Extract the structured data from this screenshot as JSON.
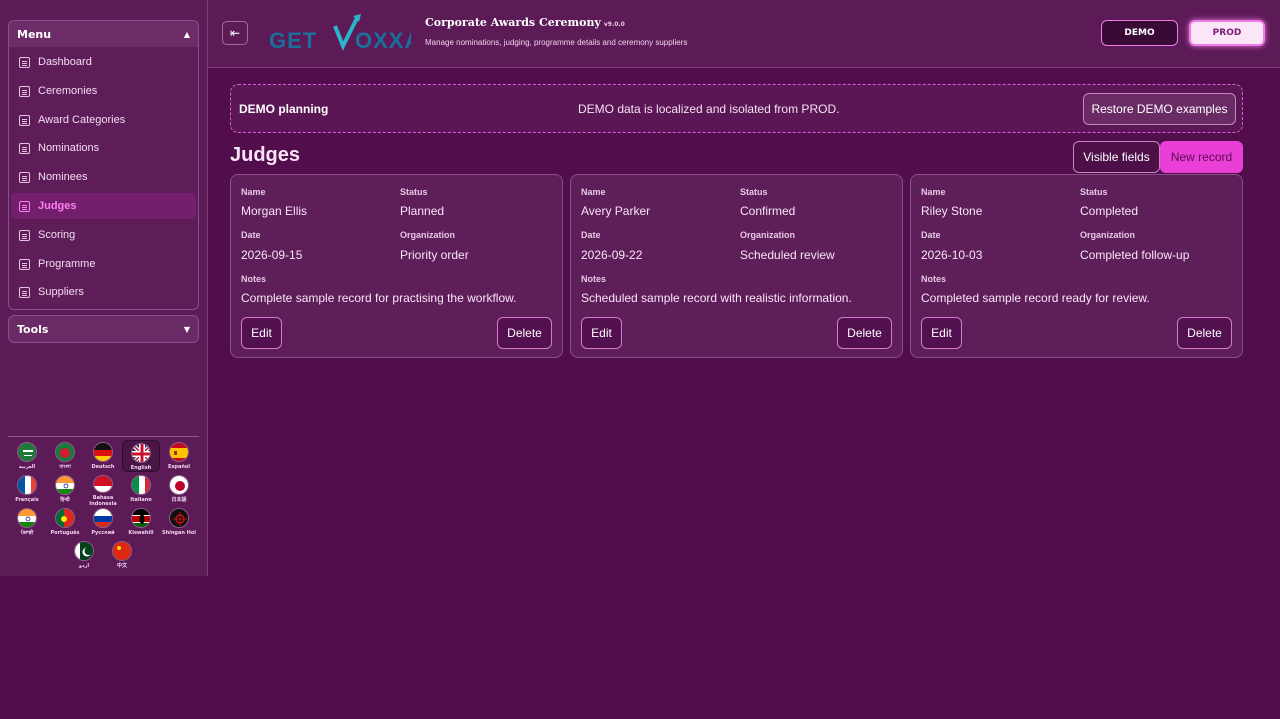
{
  "sidebar": {
    "menu_title": "Menu",
    "tools_title": "Tools",
    "items": [
      {
        "label": "Dashboard",
        "active": false
      },
      {
        "label": "Ceremonies",
        "active": false
      },
      {
        "label": "Award Categories",
        "active": false
      },
      {
        "label": "Nominations",
        "active": false
      },
      {
        "label": "Nominees",
        "active": false
      },
      {
        "label": "Judges",
        "active": true
      },
      {
        "label": "Scoring",
        "active": false
      },
      {
        "label": "Programme",
        "active": false
      },
      {
        "label": "Suppliers",
        "active": false
      }
    ],
    "languages": [
      {
        "label": "العربية",
        "flag": "saudi-arabia"
      },
      {
        "label": "বাংলা",
        "flag": "bangladesh"
      },
      {
        "label": "Deutsch",
        "flag": "germany"
      },
      {
        "label": "English",
        "flag": "united-kingdom",
        "selected": true
      },
      {
        "label": "Español",
        "flag": "spain"
      },
      {
        "label": "Français",
        "flag": "france"
      },
      {
        "label": "हिन्दी",
        "flag": "india"
      },
      {
        "label": "Bahasa Indonesia",
        "flag": "indonesia"
      },
      {
        "label": "Italiano",
        "flag": "italy"
      },
      {
        "label": "日本語",
        "flag": "japan"
      },
      {
        "label": "ਪੰਜਾਬੀ",
        "flag": "india"
      },
      {
        "label": "Português",
        "flag": "portugal"
      },
      {
        "label": "Русский",
        "flag": "russia"
      },
      {
        "label": "Kiswahili",
        "flag": "kenya"
      },
      {
        "label": "Shingan Hol",
        "flag": "klingon"
      },
      {
        "label": "اردو",
        "flag": "pakistan"
      },
      {
        "label": "中文",
        "flag": "china"
      }
    ]
  },
  "header": {
    "logo_text": "GETVOXXA",
    "app_title": "Corporate Awards Ceremony",
    "version": "v9.0.0",
    "subtitle": "Manage nominations, judging, programme details and ceremony suppliers",
    "env_demo": "DEMO",
    "env_prod": "PROD"
  },
  "banner": {
    "title": "DEMO planning",
    "message": "DEMO data is localized and isolated from PROD.",
    "restore_label": "Restore DEMO examples"
  },
  "page": {
    "title": "Judges",
    "visible_fields_label": "Visible fields",
    "new_record_label": "New record"
  },
  "field_labels": {
    "name": "Name",
    "status": "Status",
    "date": "Date",
    "organization": "Organization",
    "notes": "Notes",
    "edit": "Edit",
    "delete": "Delete"
  },
  "records": [
    {
      "name": "Morgan Ellis",
      "status": "Planned",
      "date": "2026-09-15",
      "organization": "Priority order",
      "notes": "Complete sample record for practising the workflow."
    },
    {
      "name": "Avery Parker",
      "status": "Confirmed",
      "date": "2026-09-22",
      "organization": "Scheduled review",
      "notes": "Scheduled sample record with realistic information."
    },
    {
      "name": "Riley Stone",
      "status": "Completed",
      "date": "2026-10-03",
      "organization": "Completed follow-up",
      "notes": "Completed sample record ready for review."
    }
  ]
}
